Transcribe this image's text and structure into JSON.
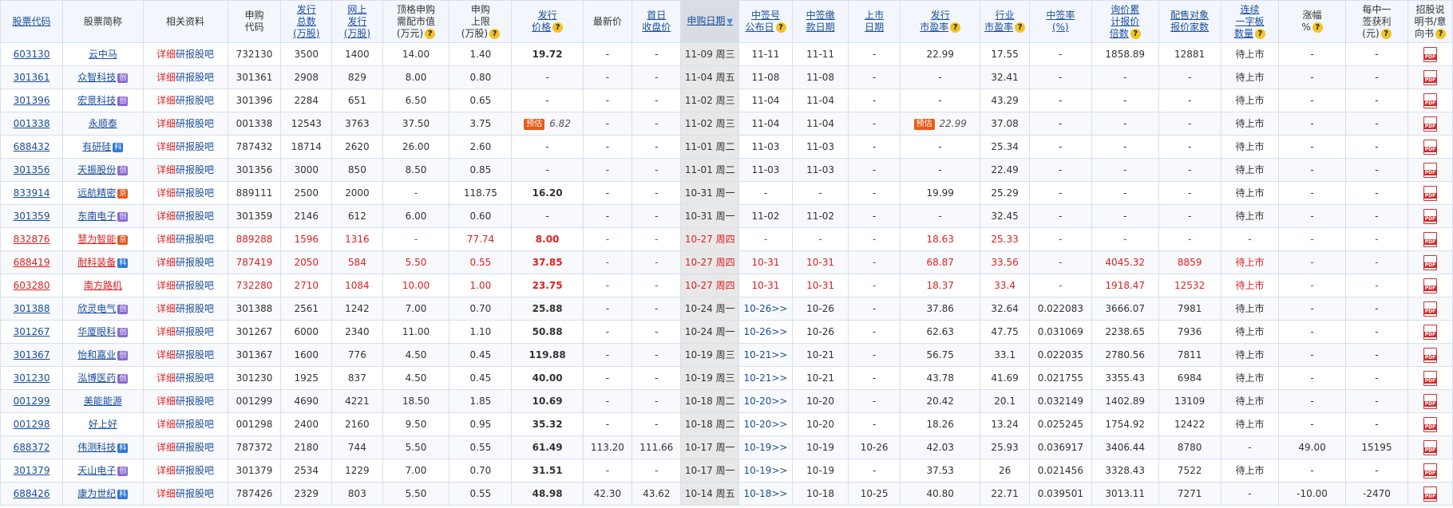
{
  "columns": [
    {
      "key": "code",
      "label": "股票代码",
      "link": true
    },
    {
      "key": "name",
      "label": "股票简称",
      "link": false
    },
    {
      "key": "info",
      "label": "相关资料",
      "link": false
    },
    {
      "key": "sub_code",
      "label": "申购\n代码",
      "link": false
    },
    {
      "key": "total",
      "label": "发行\n总数\n(万股)",
      "link": true
    },
    {
      "key": "online",
      "label": "网上\n发行\n(万股)",
      "link": true
    },
    {
      "key": "need",
      "label": "顶格申购\n需配市值\n(万元)",
      "link": false,
      "help": true
    },
    {
      "key": "limit",
      "label": "申购\n上限\n(万股)",
      "link": false,
      "help": true
    },
    {
      "key": "price",
      "label": "发行\n价格",
      "link": true,
      "help": true
    },
    {
      "key": "latest",
      "label": "最新价",
      "link": false
    },
    {
      "key": "first",
      "label": "首日\n收盘价",
      "link": true
    },
    {
      "key": "date",
      "label": "申购日期",
      "link": true,
      "sorted": true
    },
    {
      "key": "ann",
      "label": "中签号\n公布日",
      "link": true,
      "help": true
    },
    {
      "key": "pay",
      "label": "中签缴\n款日期",
      "link": true
    },
    {
      "key": "list",
      "label": "上市\n日期",
      "link": true
    },
    {
      "key": "pe",
      "label": "发行\n市盈率",
      "link": true,
      "help": true
    },
    {
      "key": "ind_pe",
      "label": "行业\n市盈率",
      "link": true,
      "help": true
    },
    {
      "key": "rate",
      "label": "中签率\n(%)",
      "link": true
    },
    {
      "key": "mult",
      "label": "询价累\n计报价\n倍数",
      "link": true,
      "help": true
    },
    {
      "key": "inst",
      "label": "配售对象\n报价家数",
      "link": true
    },
    {
      "key": "cons",
      "label": "连续\n一字板\n数量",
      "link": true,
      "help": true
    },
    {
      "key": "chg",
      "label": "涨幅\n%",
      "link": false,
      "help": true
    },
    {
      "key": "profit",
      "label": "每中一\n签获利\n(元)",
      "link": false,
      "help": true
    },
    {
      "key": "prosp",
      "label": "招股说\n明书/意\n向书",
      "link": false,
      "help": true
    }
  ],
  "links": {
    "detail": "详细",
    "research": "研报",
    "forum": "股吧"
  },
  "pdf_label": "PDF",
  "estimate_label": "预估",
  "help_glyph": "?",
  "sort_arrow": "▼",
  "rows": [
    {
      "code": "603130",
      "name": "云中马",
      "badge": "",
      "sub_code": "732130",
      "total": "3500",
      "online": "1400",
      "need": "14.00",
      "limit": "1.40",
      "price": "19.72",
      "price_est": false,
      "latest": "-",
      "first": "-",
      "date": "11-09 周三",
      "ann": "11-11",
      "ann_link": false,
      "pay": "11-11",
      "list": "-",
      "pe": "22.99",
      "pe_est": false,
      "ind_pe": "17.55",
      "rate": "-",
      "mult": "1858.89",
      "inst": "12881",
      "cons": "待上市",
      "chg": "-",
      "profit": "-",
      "red": false
    },
    {
      "code": "301361",
      "name": "众智科技",
      "badge": "创",
      "sub_code": "301361",
      "total": "2908",
      "online": "829",
      "need": "8.00",
      "limit": "0.80",
      "price": "-",
      "price_est": false,
      "latest": "-",
      "first": "-",
      "date": "11-04 周五",
      "ann": "11-08",
      "ann_link": false,
      "pay": "11-08",
      "list": "-",
      "pe": "-",
      "pe_est": false,
      "ind_pe": "32.41",
      "rate": "-",
      "mult": "-",
      "inst": "-",
      "cons": "待上市",
      "chg": "-",
      "profit": "-",
      "red": false
    },
    {
      "code": "301396",
      "name": "宏景科技",
      "badge": "创",
      "sub_code": "301396",
      "total": "2284",
      "online": "651",
      "need": "6.50",
      "limit": "0.65",
      "price": "-",
      "price_est": false,
      "latest": "-",
      "first": "-",
      "date": "11-02 周三",
      "ann": "11-04",
      "ann_link": false,
      "pay": "11-04",
      "list": "-",
      "pe": "-",
      "pe_est": false,
      "ind_pe": "43.29",
      "rate": "-",
      "mult": "-",
      "inst": "-",
      "cons": "待上市",
      "chg": "-",
      "profit": "-",
      "red": false
    },
    {
      "code": "001338",
      "name": "永顺泰",
      "badge": "",
      "sub_code": "001338",
      "total": "12543",
      "online": "3763",
      "need": "37.50",
      "limit": "3.75",
      "price": "6.82",
      "price_est": true,
      "latest": "-",
      "first": "-",
      "date": "11-02 周三",
      "ann": "11-04",
      "ann_link": false,
      "pay": "11-04",
      "list": "-",
      "pe": "22.99",
      "pe_est": true,
      "ind_pe": "37.08",
      "rate": "-",
      "mult": "-",
      "inst": "-",
      "cons": "待上市",
      "chg": "-",
      "profit": "-",
      "red": false
    },
    {
      "code": "688432",
      "name": "有研硅",
      "badge": "科",
      "sub_code": "787432",
      "total": "18714",
      "online": "2620",
      "need": "26.00",
      "limit": "2.60",
      "price": "-",
      "price_est": false,
      "latest": "-",
      "first": "-",
      "date": "11-01 周二",
      "ann": "11-03",
      "ann_link": false,
      "pay": "11-03",
      "list": "-",
      "pe": "-",
      "pe_est": false,
      "ind_pe": "25.34",
      "rate": "-",
      "mult": "-",
      "inst": "-",
      "cons": "待上市",
      "chg": "-",
      "profit": "-",
      "red": false
    },
    {
      "code": "301356",
      "name": "天振股份",
      "badge": "创",
      "sub_code": "301356",
      "total": "3000",
      "online": "850",
      "need": "8.50",
      "limit": "0.85",
      "price": "-",
      "price_est": false,
      "latest": "-",
      "first": "-",
      "date": "11-01 周二",
      "ann": "11-03",
      "ann_link": false,
      "pay": "11-03",
      "list": "-",
      "pe": "-",
      "pe_est": false,
      "ind_pe": "22.49",
      "rate": "-",
      "mult": "-",
      "inst": "-",
      "cons": "待上市",
      "chg": "-",
      "profit": "-",
      "red": false
    },
    {
      "code": "833914",
      "name": "远航精密",
      "badge": "京",
      "sub_code": "889111",
      "total": "2500",
      "online": "2000",
      "need": "-",
      "limit": "118.75",
      "price": "16.20",
      "price_est": false,
      "latest": "-",
      "first": "-",
      "date": "10-31 周一",
      "ann": "-",
      "ann_link": false,
      "pay": "-",
      "list": "-",
      "pe": "19.99",
      "pe_est": false,
      "ind_pe": "25.29",
      "rate": "-",
      "mult": "-",
      "inst": "-",
      "cons": "待上市",
      "chg": "-",
      "profit": "-",
      "red": false
    },
    {
      "code": "301359",
      "name": "东南电子",
      "badge": "创",
      "sub_code": "301359",
      "total": "2146",
      "online": "612",
      "need": "6.00",
      "limit": "0.60",
      "price": "-",
      "price_est": false,
      "latest": "-",
      "first": "-",
      "date": "10-31 周一",
      "ann": "11-02",
      "ann_link": false,
      "pay": "11-02",
      "list": "-",
      "pe": "-",
      "pe_est": false,
      "ind_pe": "32.45",
      "rate": "-",
      "mult": "-",
      "inst": "-",
      "cons": "待上市",
      "chg": "-",
      "profit": "-",
      "red": false
    },
    {
      "code": "832876",
      "name": "慧为智能",
      "badge": "京",
      "sub_code": "889288",
      "total": "1596",
      "online": "1316",
      "need": "-",
      "limit": "77.74",
      "price": "8.00",
      "price_est": false,
      "latest": "-",
      "first": "-",
      "date": "10-27 周四",
      "ann": "-",
      "ann_link": false,
      "pay": "-",
      "list": "-",
      "pe": "18.63",
      "pe_est": false,
      "ind_pe": "25.33",
      "rate": "-",
      "mult": "-",
      "inst": "-",
      "cons": "-",
      "chg": "-",
      "profit": "-",
      "red": true
    },
    {
      "code": "688419",
      "name": "耐科装备",
      "badge": "科",
      "sub_code": "787419",
      "total": "2050",
      "online": "584",
      "need": "5.50",
      "limit": "0.55",
      "price": "37.85",
      "price_est": false,
      "latest": "-",
      "first": "-",
      "date": "10-27 周四",
      "ann": "10-31",
      "ann_link": false,
      "pay": "10-31",
      "list": "-",
      "pe": "68.87",
      "pe_est": false,
      "ind_pe": "33.56",
      "rate": "-",
      "mult": "4045.32",
      "inst": "8859",
      "cons": "待上市",
      "chg": "-",
      "profit": "-",
      "red": true
    },
    {
      "code": "603280",
      "name": "南方路机",
      "badge": "",
      "sub_code": "732280",
      "total": "2710",
      "online": "1084",
      "need": "10.00",
      "limit": "1.00",
      "price": "23.75",
      "price_est": false,
      "latest": "-",
      "first": "-",
      "date": "10-27 周四",
      "ann": "10-31",
      "ann_link": false,
      "pay": "10-31",
      "list": "-",
      "pe": "18.37",
      "pe_est": false,
      "ind_pe": "33.4",
      "rate": "-",
      "mult": "1918.47",
      "inst": "12532",
      "cons": "待上市",
      "chg": "-",
      "profit": "-",
      "red": true
    },
    {
      "code": "301388",
      "name": "欣灵电气",
      "badge": "创",
      "sub_code": "301388",
      "total": "2561",
      "online": "1242",
      "need": "7.00",
      "limit": "0.70",
      "price": "25.88",
      "price_est": false,
      "latest": "-",
      "first": "-",
      "date": "10-24 周一",
      "ann": "10-26>>",
      "ann_link": true,
      "pay": "10-26",
      "list": "-",
      "pe": "37.86",
      "pe_est": false,
      "ind_pe": "32.64",
      "rate": "0.022083",
      "mult": "3666.07",
      "inst": "7981",
      "cons": "待上市",
      "chg": "-",
      "profit": "-",
      "red": false
    },
    {
      "code": "301267",
      "name": "华厦眼科",
      "badge": "创",
      "sub_code": "301267",
      "total": "6000",
      "online": "2340",
      "need": "11.00",
      "limit": "1.10",
      "price": "50.88",
      "price_est": false,
      "latest": "-",
      "first": "-",
      "date": "10-24 周一",
      "ann": "10-26>>",
      "ann_link": true,
      "pay": "10-26",
      "list": "-",
      "pe": "62.63",
      "pe_est": false,
      "ind_pe": "47.75",
      "rate": "0.031069",
      "mult": "2238.65",
      "inst": "7936",
      "cons": "待上市",
      "chg": "-",
      "profit": "-",
      "red": false
    },
    {
      "code": "301367",
      "name": "怡和嘉业",
      "badge": "创",
      "sub_code": "301367",
      "total": "1600",
      "online": "776",
      "need": "4.50",
      "limit": "0.45",
      "price": "119.88",
      "price_est": false,
      "latest": "-",
      "first": "-",
      "date": "10-19 周三",
      "ann": "10-21>>",
      "ann_link": true,
      "pay": "10-21",
      "list": "-",
      "pe": "56.75",
      "pe_est": false,
      "ind_pe": "33.1",
      "rate": "0.022035",
      "mult": "2780.56",
      "inst": "7811",
      "cons": "待上市",
      "chg": "-",
      "profit": "-",
      "red": false
    },
    {
      "code": "301230",
      "name": "泓博医药",
      "badge": "创",
      "sub_code": "301230",
      "total": "1925",
      "online": "837",
      "need": "4.50",
      "limit": "0.45",
      "price": "40.00",
      "price_est": false,
      "latest": "-",
      "first": "-",
      "date": "10-19 周三",
      "ann": "10-21>>",
      "ann_link": true,
      "pay": "10-21",
      "list": "-",
      "pe": "43.78",
      "pe_est": false,
      "ind_pe": "41.69",
      "rate": "0.021755",
      "mult": "3355.43",
      "inst": "6984",
      "cons": "待上市",
      "chg": "-",
      "profit": "-",
      "red": false
    },
    {
      "code": "001299",
      "name": "美能能源",
      "badge": "",
      "sub_code": "001299",
      "total": "4690",
      "online": "4221",
      "need": "18.50",
      "limit": "1.85",
      "price": "10.69",
      "price_est": false,
      "latest": "-",
      "first": "-",
      "date": "10-18 周二",
      "ann": "10-20>>",
      "ann_link": true,
      "pay": "10-20",
      "list": "-",
      "pe": "20.42",
      "pe_est": false,
      "ind_pe": "20.1",
      "rate": "0.032149",
      "mult": "1402.89",
      "inst": "13109",
      "cons": "待上市",
      "chg": "-",
      "profit": "-",
      "red": false
    },
    {
      "code": "001298",
      "name": "好上好",
      "badge": "",
      "sub_code": "001298",
      "total": "2400",
      "online": "2160",
      "need": "9.50",
      "limit": "0.95",
      "price": "35.32",
      "price_est": false,
      "latest": "-",
      "first": "-",
      "date": "10-18 周二",
      "ann": "10-20>>",
      "ann_link": true,
      "pay": "10-20",
      "list": "-",
      "pe": "18.26",
      "pe_est": false,
      "ind_pe": "13.24",
      "rate": "0.025245",
      "mult": "1754.92",
      "inst": "12422",
      "cons": "待上市",
      "chg": "-",
      "profit": "-",
      "red": false
    },
    {
      "code": "688372",
      "name": "伟测科技",
      "badge": "科",
      "sub_code": "787372",
      "total": "2180",
      "online": "744",
      "need": "5.50",
      "limit": "0.55",
      "price": "61.49",
      "price_est": false,
      "latest": "113.20",
      "first": "111.66",
      "date": "10-17 周一",
      "ann": "10-19>>",
      "ann_link": true,
      "pay": "10-19",
      "list": "10-26",
      "pe": "42.03",
      "pe_est": false,
      "ind_pe": "25.93",
      "rate": "0.036917",
      "mult": "3406.44",
      "inst": "8780",
      "cons": "-",
      "chg": "49.00",
      "profit": "15195",
      "red": false
    },
    {
      "code": "301379",
      "name": "天山电子",
      "badge": "创",
      "sub_code": "301379",
      "total": "2534",
      "online": "1229",
      "need": "7.00",
      "limit": "0.70",
      "price": "31.51",
      "price_est": false,
      "latest": "-",
      "first": "-",
      "date": "10-17 周一",
      "ann": "10-19>>",
      "ann_link": true,
      "pay": "10-19",
      "list": "-",
      "pe": "37.53",
      "pe_est": false,
      "ind_pe": "26",
      "rate": "0.021456",
      "mult": "3328.43",
      "inst": "7522",
      "cons": "待上市",
      "chg": "-",
      "profit": "-",
      "red": false
    },
    {
      "code": "688426",
      "name": "康为世纪",
      "badge": "科",
      "sub_code": "787426",
      "total": "2329",
      "online": "803",
      "need": "5.50",
      "limit": "0.55",
      "price": "48.98",
      "price_est": false,
      "latest": "42.30",
      "first": "43.62",
      "date": "10-14 周五",
      "ann": "10-18>>",
      "ann_link": true,
      "pay": "10-18",
      "list": "10-25",
      "pe": "40.80",
      "pe_est": false,
      "ind_pe": "22.71",
      "rate": "0.039501",
      "mult": "3013.11",
      "inst": "7271",
      "cons": "-",
      "chg": "-10.00",
      "profit": "-2470",
      "red": false
    }
  ]
}
